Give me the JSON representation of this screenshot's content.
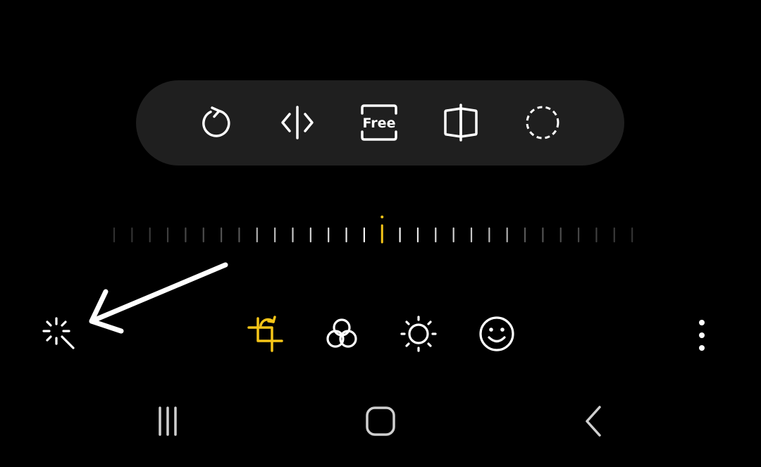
{
  "colors": {
    "background": "#000000",
    "toolbar_background": "#1f1f1f",
    "icon": "#ffffff",
    "accent": "#f5c518",
    "ruler_tick": "#8a8a8a"
  },
  "crop_toolbar": {
    "items": [
      {
        "id": "rotate",
        "icon": "rotate-icon"
      },
      {
        "id": "flip",
        "icon": "flip-horizontal-icon"
      },
      {
        "id": "aspect-ratio",
        "icon": "aspect-ratio-free-icon",
        "label": "Free"
      },
      {
        "id": "perspective",
        "icon": "perspective-icon"
      },
      {
        "id": "lasso",
        "icon": "lasso-icon"
      }
    ]
  },
  "angle_ruler": {
    "tick_count": 30,
    "selected_value": 0
  },
  "editor_tools": {
    "items": [
      {
        "id": "auto-enhance",
        "icon": "magic-wand-icon",
        "active": false
      },
      {
        "id": "transform",
        "icon": "crop-rotate-icon",
        "active": true
      },
      {
        "id": "filters",
        "icon": "filters-icon",
        "active": false
      },
      {
        "id": "tone",
        "icon": "brightness-icon",
        "active": false
      },
      {
        "id": "decorations",
        "icon": "smiley-icon",
        "active": false
      },
      {
        "id": "more",
        "icon": "more-vertical-icon",
        "active": false
      }
    ]
  },
  "system_nav": {
    "items": [
      {
        "id": "recent-apps",
        "icon": "recent-apps-icon"
      },
      {
        "id": "home",
        "icon": "home-icon"
      },
      {
        "id": "back",
        "icon": "back-icon"
      }
    ]
  }
}
